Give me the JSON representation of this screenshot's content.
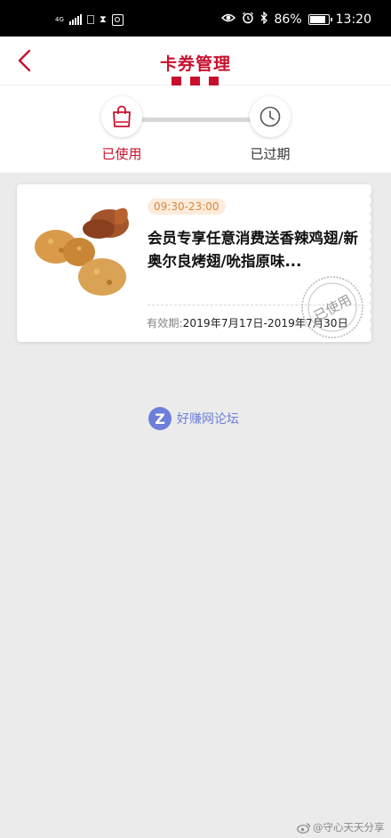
{
  "status_bar": {
    "network_label": "4G",
    "hourglass_glyph": "⧗",
    "battery": "86%",
    "time": "13:20",
    "battery_level": 0.86
  },
  "header": {
    "title": "卡券管理",
    "back_icon": "chevron-left-icon"
  },
  "tabs": [
    {
      "label": "已使用",
      "icon": "shopping-bag-icon",
      "active": true
    },
    {
      "label": "已过期",
      "icon": "clock-icon",
      "active": false
    }
  ],
  "coupon": {
    "time_range": "09:30-23:00",
    "name": "会员专享任意消费送香辣鸡翅/新奥尔良烤翅/吮指原味...",
    "validity_label": "有效期:",
    "validity_dates": "2019年7月17日-2019年7月30日",
    "stamp_text": "已使用"
  },
  "watermark": {
    "logo_letter": "Z",
    "text": "好赚网论坛"
  },
  "credit": {
    "text": "@守心天天分享"
  },
  "colors": {
    "brand_red": "#c8102e",
    "badge_bg": "#fdebdc",
    "badge_text": "#d68b3c",
    "page_bg": "#ebebeb"
  }
}
